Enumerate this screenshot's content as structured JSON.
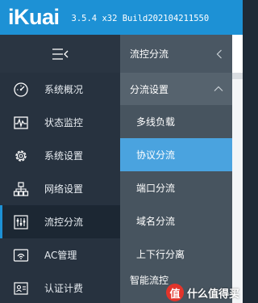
{
  "header": {
    "logo_text": "iKuai",
    "version": "3.5.4 x32 Build202104211550"
  },
  "sidebar": {
    "items": [
      {
        "label": "系统概况",
        "icon": "dashboard-icon",
        "active": false
      },
      {
        "label": "状态监控",
        "icon": "monitor-icon",
        "active": false
      },
      {
        "label": "系统设置",
        "icon": "gear-icon",
        "active": false
      },
      {
        "label": "网络设置",
        "icon": "network-icon",
        "active": false
      },
      {
        "label": "流控分流",
        "icon": "sliders-icon",
        "active": true
      },
      {
        "label": "AC管理",
        "icon": "ac-icon",
        "active": false
      },
      {
        "label": "认证计费",
        "icon": "id-card-icon",
        "active": false
      }
    ]
  },
  "submenu": {
    "title": "流控分流",
    "group_label": "分流设置",
    "items": [
      {
        "label": "多线负载",
        "active": false
      },
      {
        "label": "协议分流",
        "active": true
      },
      {
        "label": "端口分流",
        "active": false
      },
      {
        "label": "域名分流",
        "active": false
      },
      {
        "label": "上下行分离",
        "active": false
      },
      {
        "label": "智能流控",
        "active": false
      }
    ]
  },
  "watermark": {
    "badge": "值",
    "text": "什么值得买"
  },
  "colors": {
    "header_bg": "#1d91d5",
    "sidebar_bg": "#27323f",
    "submenu_bg": "#47545f",
    "submenu_active": "#4aa3df",
    "accent": "#1d91d5"
  }
}
